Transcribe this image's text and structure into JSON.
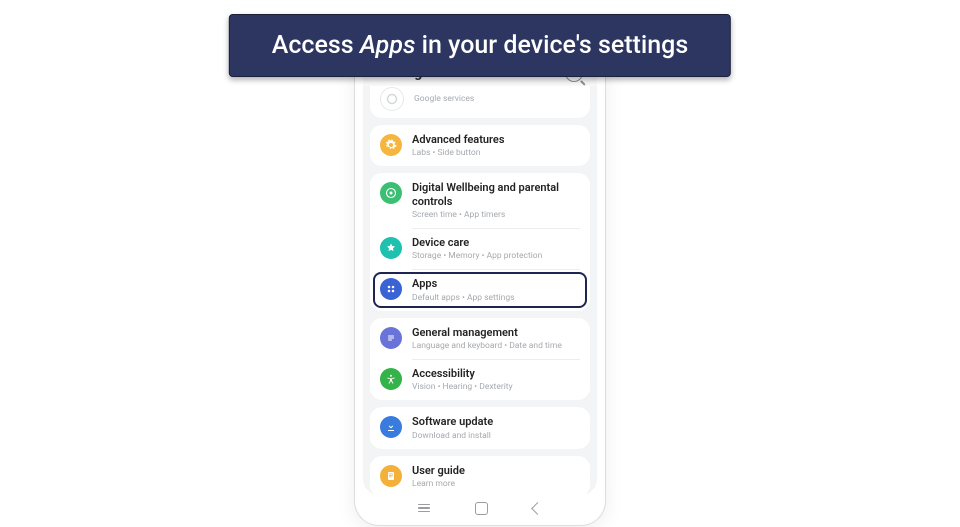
{
  "banner": {
    "prefix": "Access ",
    "emph": "Apps",
    "suffix": " in your device's settings"
  },
  "header": {
    "title": "Settings"
  },
  "ghost": {
    "sub": "Google services"
  },
  "groups": [
    {
      "rows": [
        {
          "icon": "gear-icon",
          "color": "#f6b63e",
          "label": "Advanced features",
          "sub": "Labs  •  Side button"
        }
      ]
    },
    {
      "rows": [
        {
          "icon": "wellbeing-icon",
          "color": "#3bbf72",
          "label": "Digital Wellbeing and parental controls",
          "sub": "Screen time  •  App timers"
        },
        {
          "icon": "care-icon",
          "color": "#1ec0b0",
          "label": "Device care",
          "sub": "Storage  •  Memory  •  App protection"
        },
        {
          "icon": "apps-icon",
          "color": "#3a63d6",
          "label": "Apps",
          "sub": "Default apps  •  App settings",
          "highlighted": true
        }
      ]
    },
    {
      "rows": [
        {
          "icon": "general-icon",
          "color": "#6a74d8",
          "label": "General management",
          "sub": "Language and keyboard  •  Date and time"
        },
        {
          "icon": "accessibility-icon",
          "color": "#36b24a",
          "label": "Accessibility",
          "sub": "Vision  •  Hearing  •  Dexterity"
        }
      ]
    },
    {
      "rows": [
        {
          "icon": "update-icon",
          "color": "#3a7bde",
          "label": "Software update",
          "sub": "Download and install"
        }
      ]
    },
    {
      "rows": [
        {
          "icon": "guide-icon",
          "color": "#f3b13a",
          "label": "User guide",
          "sub": "Learn more"
        }
      ]
    }
  ]
}
